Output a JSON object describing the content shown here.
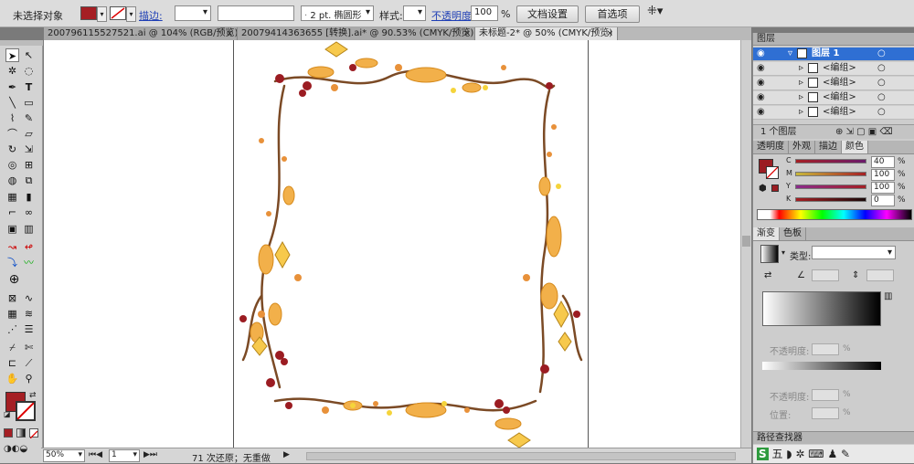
{
  "control_bar": {
    "no_selection": "未选择对象",
    "stroke_label": "描边:",
    "stroke_weight": "2 pt.",
    "brush": "椭圆形",
    "style_label": "样式:",
    "opacity_label": "不透明度:",
    "opacity_value": "100",
    "opacity_unit": "%",
    "doc_setup_button": "文档设置",
    "preferences_button": "首选项"
  },
  "tabs": [
    {
      "label": "20079611552​7521.ai @ 104% (RGB/预览)",
      "close": "×"
    },
    {
      "label": "20079414363655 [转换].ai* @ 90.53% (CMYK/预览)",
      "close": "×"
    },
    {
      "label": "未标题-2* @ 50% (CMYK/预览)",
      "close": "×"
    }
  ],
  "status": {
    "zoom": "50%",
    "page": "1",
    "history": "71 次还原；无重做"
  },
  "layers": {
    "title": "图层",
    "rows": [
      "图层 1",
      "<编组>",
      "<编组>",
      "<编组>",
      "<编组>"
    ],
    "count": "1 个图层"
  },
  "color": {
    "tabs": [
      "透明度",
      "外观",
      "描边",
      "颜色"
    ],
    "channels": [
      {
        "label": "C",
        "value": "40",
        "unit": "%",
        "color": "#00a0e0"
      },
      {
        "label": "M",
        "value": "100",
        "unit": "%",
        "color": "#d0007a"
      },
      {
        "label": "Y",
        "value": "100",
        "unit": "%",
        "color": "#e6d000"
      },
      {
        "label": "K",
        "value": "0",
        "unit": "%",
        "color": "#222222"
      }
    ],
    "fill": "#9b1c22"
  },
  "gradient": {
    "tabs": [
      "渐变",
      "色板"
    ],
    "type_label": "类型:",
    "opacity_label": "不透明度:",
    "pct": "%",
    "opacity_label2": "不透明度:",
    "location_label": "位置:",
    "bottom_panel": "路径查找器"
  },
  "colors": {
    "accent_red": "#a51f24",
    "selection_blue": "#2f6fd3"
  }
}
